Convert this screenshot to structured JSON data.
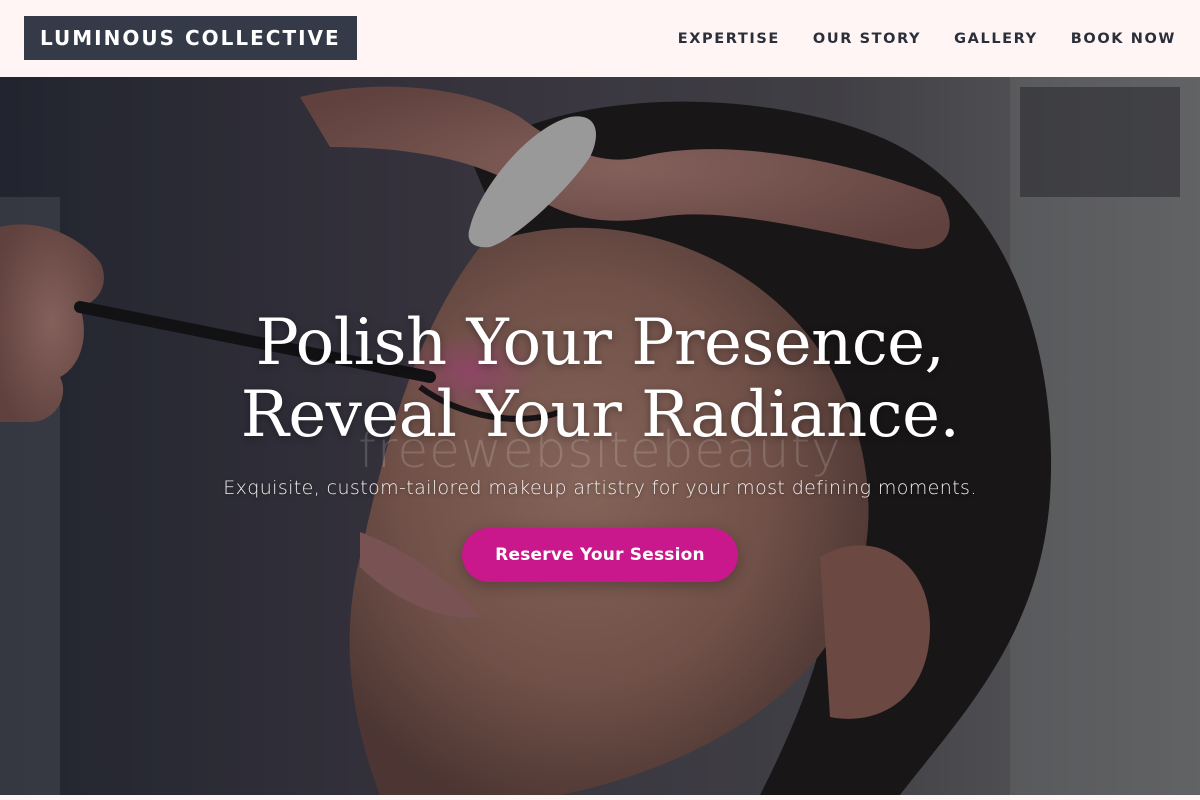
{
  "header": {
    "logo_text": "LUMINOUS COLLECTIVE",
    "nav": [
      {
        "label": "EXPERTISE"
      },
      {
        "label": "OUR STORY"
      },
      {
        "label": "GALLERY"
      },
      {
        "label": "BOOK NOW"
      }
    ]
  },
  "hero": {
    "title_line1": "Polish Your Presence,",
    "title_line2": "Reveal Your Radiance.",
    "subtitle": "Exquisite, custom-tailored makeup artistry for your most defining moments.",
    "cta_label": "Reserve Your Session",
    "watermark": "freewebsitebeauty"
  },
  "colors": {
    "header_bg": "#fff5f5",
    "logo_bg": "#353a48",
    "nav_text": "#2b2f3a",
    "cta_bg": "#c8188c",
    "hero_text": "#ffffff"
  }
}
